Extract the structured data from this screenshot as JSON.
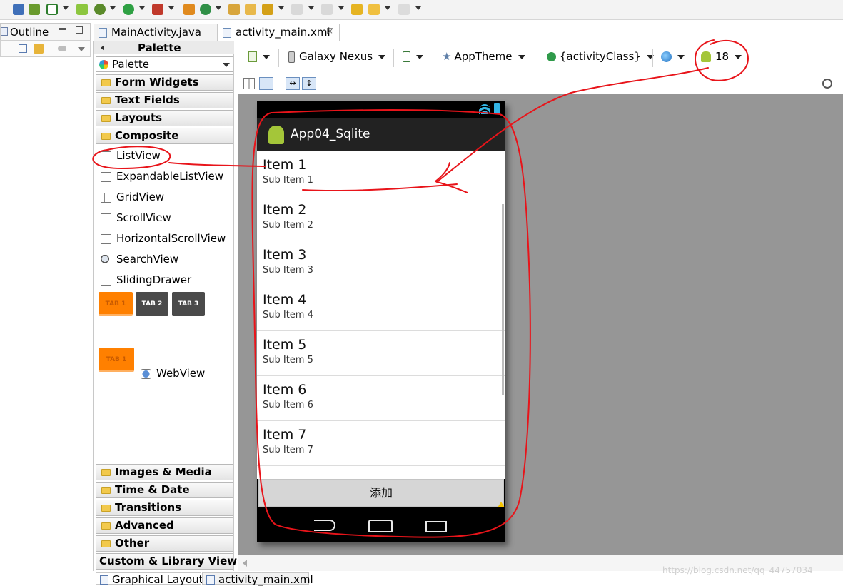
{
  "outline": {
    "title": "Outline"
  },
  "editor_tabs": [
    {
      "label": "MainActivity.java"
    },
    {
      "label": "activity_main.xml",
      "close": "☒"
    }
  ],
  "palette": {
    "header": "Palette",
    "selector": "Palette",
    "categories_top": [
      "Form Widgets",
      "Text Fields",
      "Layouts",
      "Composite"
    ],
    "composite_items": [
      "ListView",
      "ExpandableListView",
      "GridView",
      "ScrollView",
      "HorizontalScrollView",
      "SearchView",
      "SlidingDrawer"
    ],
    "tab_widget": [
      "TAB 1",
      "TAB 2",
      "TAB 3"
    ],
    "tab_small": "TAB 1",
    "webview": "WebView",
    "categories_bottom": [
      "Images & Media",
      "Time & Date",
      "Transitions",
      "Advanced",
      "Other",
      "Custom & Library Views"
    ]
  },
  "layout_toolbar": {
    "device": "Galaxy Nexus",
    "theme": "AppTheme",
    "activity": "{activityClass}",
    "api_level": "18"
  },
  "phone": {
    "app_title": "App04_Sqlite",
    "list_items": [
      {
        "title": "Item 1",
        "subtitle": "Sub Item 1"
      },
      {
        "title": "Item 2",
        "subtitle": "Sub Item 2"
      },
      {
        "title": "Item 3",
        "subtitle": "Sub Item 3"
      },
      {
        "title": "Item 4",
        "subtitle": "Sub Item 4"
      },
      {
        "title": "Item 5",
        "subtitle": "Sub Item 5"
      },
      {
        "title": "Item 6",
        "subtitle": "Sub Item 6"
      },
      {
        "title": "Item 7",
        "subtitle": "Sub Item 7"
      }
    ],
    "add_button": "添加"
  },
  "bottom_tabs": [
    "Graphical Layout",
    "activity_main.xml"
  ],
  "watermark": "https://blog.csdn.net/qq_44757034",
  "colors": {
    "annotation": "#e8141a",
    "tab_active": "#ff8000",
    "tab_inactive": "#4a4a4a",
    "android_green": "#a4c639"
  }
}
